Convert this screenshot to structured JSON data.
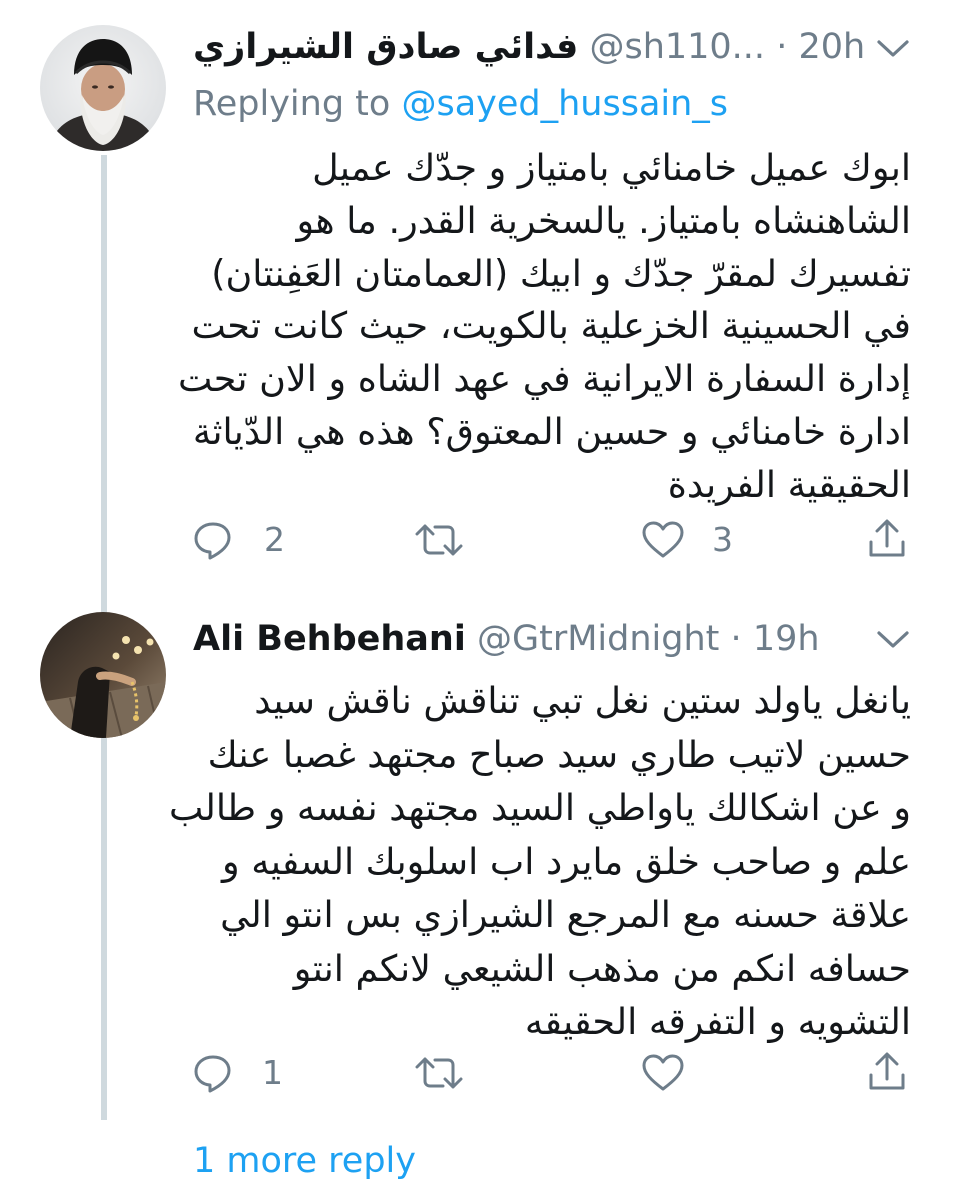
{
  "thread": {
    "tweets": [
      {
        "display_name": "فدائي صادق الشيرازي",
        "handle": "@sh110...",
        "separator": "·",
        "time": "20h",
        "replying_prefix": "Replying to",
        "replying_to": "@sayed_hussain_s",
        "text_lines": [
          "ابوك عميل خامنائي بامتياز و جدّك عميل",
          "الشاهنشاه بامتياز. يالسخرية القدر. ما هو",
          "تفسيرك لمقرّ جدّك و ابيك (العمامتان العَفِنتان)",
          "في الحسينية الخزعلية بالكويت، حيث كانت تحت",
          "إدارة السفارة الايرانية في عهد الشاه و الان تحت",
          "ادارة خامنائي و حسين المعتوق؟ هذه هي الدّياثة",
          "الحقيقية الفريدة"
        ],
        "reply_count": "2",
        "retweet_count": "",
        "like_count": "3",
        "avatar_icon": "cleric-portrait-avatar",
        "menu_icon": "chevron-down-icon"
      },
      {
        "display_name": "Ali Behbehani",
        "handle": "@GtrMidnight",
        "separator": "·",
        "time": "19h",
        "text_lines": [
          "يانغل ياولد ستين نغل تبي تناقش ناقش سيد",
          "حسين لاتيب طاري سيد صباح مجتهد غصبا عنك",
          "و عن اشكالك ياواطي السيد مجتهد نفسه و طالب",
          "علم و صاحب خلق مايرد اب اسلوبك السفيه و",
          "علاقة حسنه مع المرجع الشيرازي بس انتو الي",
          "حسافه انكم من مذهب الشيعي لانكم انتو",
          "التشويه و التفرقه الحقيقه"
        ],
        "reply_count": "1",
        "retweet_count": "",
        "like_count": "",
        "avatar_icon": "prayer-beads-photo-avatar",
        "menu_icon": "chevron-down-icon"
      }
    ],
    "more_replies_label": "1 more reply"
  },
  "colors": {
    "text": "#14171a",
    "muted": "#6e7d8a",
    "link": "#1da1f2",
    "thread_line": "#cfd9de"
  },
  "icons": {
    "reply": "reply-bubble-icon",
    "retweet": "retweet-icon",
    "like": "heart-icon",
    "share": "share-icon"
  }
}
